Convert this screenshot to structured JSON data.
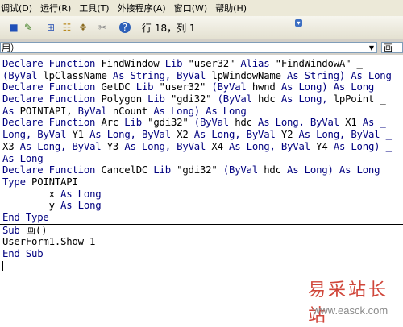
{
  "menu": [
    "调试(D)",
    "运行(R)",
    "工具(T)",
    "外接程序(A)",
    "窗口(W)",
    "帮助(H)"
  ],
  "toolbar": {
    "icons": [
      "stop-icon",
      "design-mode-icon",
      "project-explorer-icon",
      "properties-icon",
      "object-browser-icon",
      "toolbox-icon",
      "help-icon"
    ],
    "position": "行 18，列 1"
  },
  "object_box": {
    "value": "用）",
    "proc_value": "画"
  },
  "code_lines": [
    [
      {
        "t": "Declare Function ",
        "k": 1
      },
      {
        "t": "FindWindow ",
        "k": 0
      },
      {
        "t": "Lib ",
        "k": 1
      },
      {
        "t": "\"user32\" ",
        "k": 0
      },
      {
        "t": "Alias ",
        "k": 1
      },
      {
        "t": "\"FindWindowA\" _",
        "k": 0
      }
    ],
    [
      {
        "t": "(ByVal ",
        "k": 1
      },
      {
        "t": "lpClassName ",
        "k": 0
      },
      {
        "t": "As String, ",
        "k": 1
      },
      {
        "t": "ByVal ",
        "k": 1
      },
      {
        "t": "lpWindowName ",
        "k": 0
      },
      {
        "t": "As String) As Long",
        "k": 1
      }
    ],
    [
      {
        "t": "Declare Function ",
        "k": 1
      },
      {
        "t": "GetDC ",
        "k": 0
      },
      {
        "t": "Lib ",
        "k": 1
      },
      {
        "t": "\"user32\" ",
        "k": 0
      },
      {
        "t": "(ByVal ",
        "k": 1
      },
      {
        "t": "hwnd ",
        "k": 0
      },
      {
        "t": "As Long) As Long",
        "k": 1
      }
    ],
    [
      {
        "t": "Declare Function ",
        "k": 1
      },
      {
        "t": "Polygon ",
        "k": 0
      },
      {
        "t": "Lib ",
        "k": 1
      },
      {
        "t": "\"gdi32\" ",
        "k": 0
      },
      {
        "t": "(ByVal ",
        "k": 1
      },
      {
        "t": "hdc ",
        "k": 0
      },
      {
        "t": "As Long, ",
        "k": 1
      },
      {
        "t": "lpPoint _",
        "k": 0
      }
    ],
    [
      {
        "t": "As ",
        "k": 1
      },
      {
        "t": "POINTAPI, ",
        "k": 0
      },
      {
        "t": "ByVal ",
        "k": 1
      },
      {
        "t": "nCount ",
        "k": 0
      },
      {
        "t": "As Long) As Long",
        "k": 1
      }
    ],
    [
      {
        "t": "Declare Function ",
        "k": 1
      },
      {
        "t": "Arc ",
        "k": 0
      },
      {
        "t": "Lib ",
        "k": 1
      },
      {
        "t": "\"gdi32\" ",
        "k": 0
      },
      {
        "t": "(ByVal ",
        "k": 1
      },
      {
        "t": "hdc ",
        "k": 0
      },
      {
        "t": "As Long, ",
        "k": 1
      },
      {
        "t": "ByVal ",
        "k": 1
      },
      {
        "t": "X1 ",
        "k": 0
      },
      {
        "t": "As _",
        "k": 1
      }
    ],
    [
      {
        "t": "Long, ",
        "k": 1
      },
      {
        "t": "ByVal ",
        "k": 1
      },
      {
        "t": "Y1 ",
        "k": 0
      },
      {
        "t": "As Long, ",
        "k": 1
      },
      {
        "t": "ByVal ",
        "k": 1
      },
      {
        "t": "X2 ",
        "k": 0
      },
      {
        "t": "As Long, ",
        "k": 1
      },
      {
        "t": "ByVal ",
        "k": 1
      },
      {
        "t": "Y2 ",
        "k": 0
      },
      {
        "t": "As Long, ",
        "k": 1
      },
      {
        "t": "ByVal _",
        "k": 1
      }
    ],
    [
      {
        "t": "X3 ",
        "k": 0
      },
      {
        "t": "As Long, ",
        "k": 1
      },
      {
        "t": "ByVal ",
        "k": 1
      },
      {
        "t": "Y3 ",
        "k": 0
      },
      {
        "t": "As Long, ",
        "k": 1
      },
      {
        "t": "ByVal ",
        "k": 1
      },
      {
        "t": "X4 ",
        "k": 0
      },
      {
        "t": "As Long, ",
        "k": 1
      },
      {
        "t": "ByVal ",
        "k": 1
      },
      {
        "t": "Y4 ",
        "k": 0
      },
      {
        "t": "As Long) _",
        "k": 1
      }
    ],
    [
      {
        "t": "As Long",
        "k": 1
      }
    ],
    [
      {
        "t": "Declare Function ",
        "k": 1
      },
      {
        "t": "CancelDC ",
        "k": 0
      },
      {
        "t": "Lib ",
        "k": 1
      },
      {
        "t": "\"gdi32\" ",
        "k": 0
      },
      {
        "t": "(ByVal ",
        "k": 1
      },
      {
        "t": "hdc ",
        "k": 0
      },
      {
        "t": "As Long) As Long",
        "k": 1
      }
    ],
    [
      {
        "t": "Type ",
        "k": 1
      },
      {
        "t": "POINTAPI",
        "k": 0
      }
    ],
    [
      {
        "t": "        x ",
        "k": 0
      },
      {
        "t": "As Long",
        "k": 1
      }
    ],
    [
      {
        "t": "        y ",
        "k": 0
      },
      {
        "t": "As Long",
        "k": 1
      }
    ],
    [
      {
        "t": "End Type",
        "k": 1
      }
    ]
  ],
  "code_lines_2": [
    [
      {
        "t": "Sub ",
        "k": 1
      },
      {
        "t": "画()",
        "k": 0
      }
    ],
    [
      {
        "t": "UserForm1.Show 1",
        "k": 0
      }
    ],
    [
      {
        "t": "End Sub",
        "k": 1
      }
    ]
  ],
  "watermark": {
    "title": "易采站长站",
    "url": "www.easck.com"
  }
}
